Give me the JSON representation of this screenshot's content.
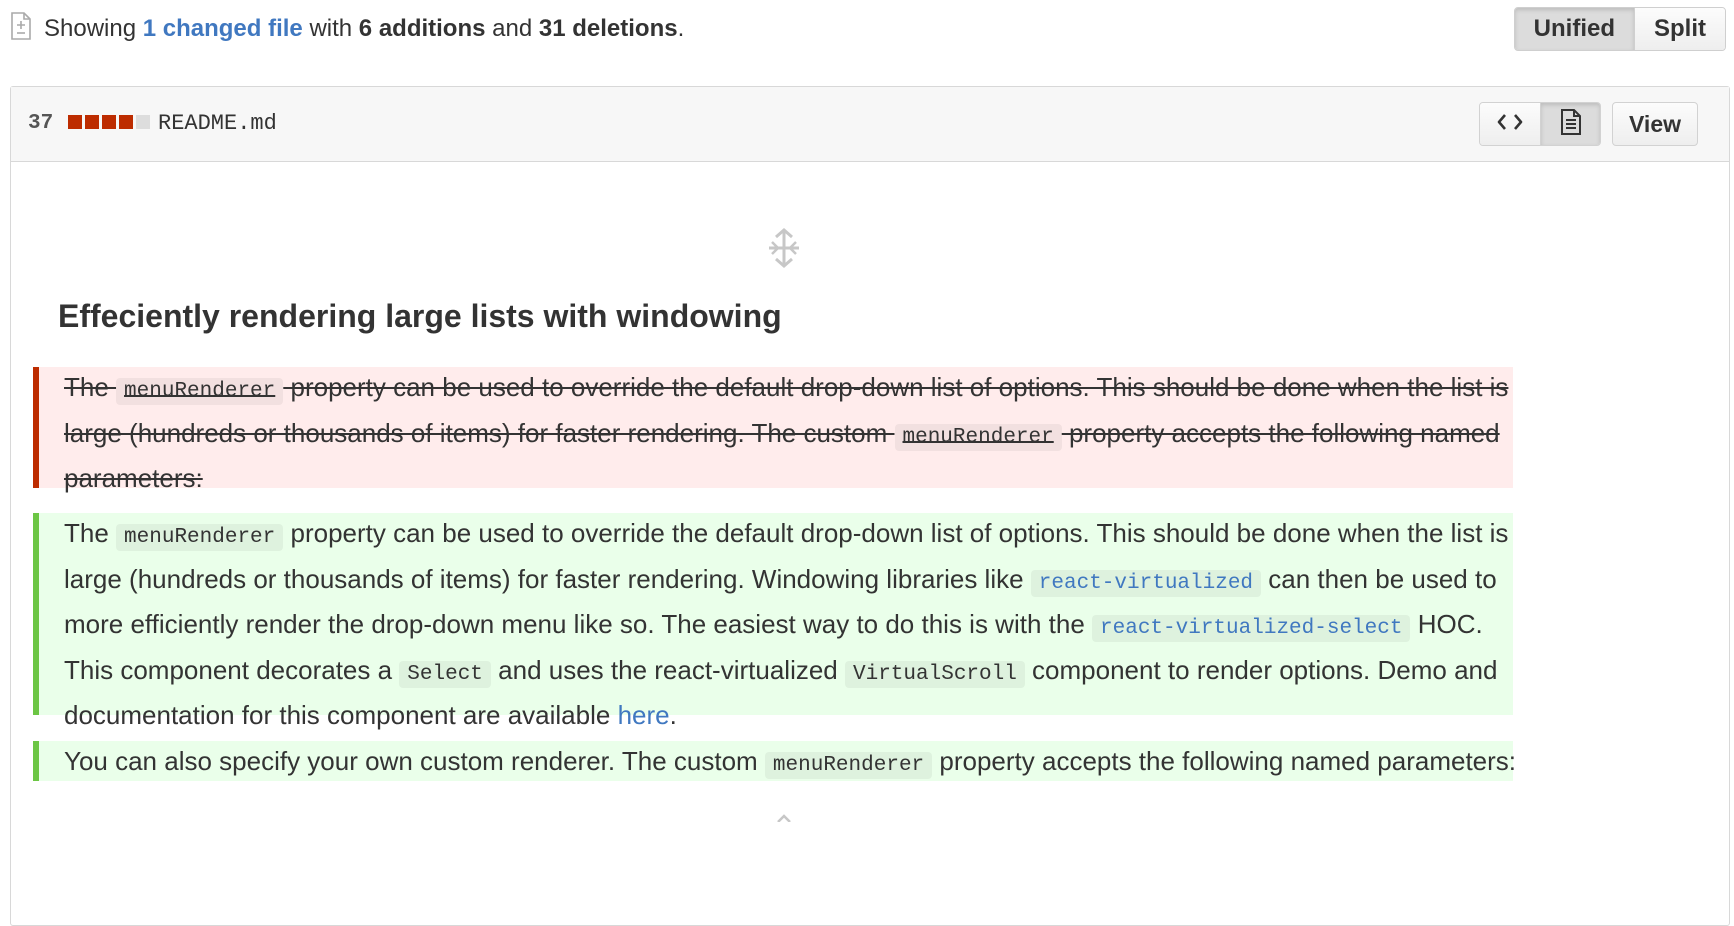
{
  "summary": {
    "prefix": "Showing ",
    "changed_files": "1 changed file",
    "with": " with ",
    "additions": "6 additions",
    "and": " and ",
    "deletions": "31 deletions",
    "suffix": ".",
    "icon": "diff-file-icon"
  },
  "view_toggle": {
    "unified": "Unified",
    "split": "Split",
    "active": "Unified"
  },
  "file": {
    "change_count": "37",
    "diffstat": {
      "deletion_blocks": 4,
      "neutral_blocks": 1,
      "deletion_color": "#bd2c00"
    },
    "name": "README.md",
    "source_view_icon": "code-icon",
    "rich_view_icon": "file-text-icon",
    "active_view": "rich",
    "view_button": "View"
  },
  "content": {
    "expand_icon": "unfold-icon",
    "heading": "Effeciently rendering large lists with windowing",
    "removed": {
      "l1_a": "The ",
      "l1_code": "menuRenderer",
      "l1_b": " property can be used to override the default drop-down list of options. This should be done when the list is",
      "l2_a": "large (hundreds or thousands of items) for faster rendering. The custom ",
      "l2_code": "menuRenderer",
      "l2_b": " property accepts the following named",
      "l3": "parameters:"
    },
    "added_p1": {
      "l1_a": "The ",
      "l1_code": "menuRenderer",
      "l1_b": " property can be used to override the default drop-down list of options. This should be done when the list is",
      "l2_a": "large (hundreds or thousands of items) for faster rendering. Windowing libraries like ",
      "l2_link": "react-virtualized",
      "l2_b": " can then be used to",
      "l3_a": "more efficiently render the drop-down menu like so. The easiest way to do this is with the ",
      "l3_link": "react-virtualized-select",
      "l3_b": " HOC.",
      "l4_a": "This component decorates a ",
      "l4_code1": "Select",
      "l4_b": " and uses the react-virtualized ",
      "l4_code2": "VirtualScroll",
      "l4_c": " component to render options. Demo and",
      "l5_a": "documentation for this component are available ",
      "l5_link": "here",
      "l5_b": "."
    },
    "added_p2": {
      "a": "You can also specify your own custom renderer. The custom ",
      "code": "menuRenderer",
      "b": " property accepts the following named parameters:"
    }
  },
  "colors": {
    "link": "#4078c0",
    "deletion_bg": "#ffecec",
    "deletion_border": "#bd2c00",
    "addition_bg": "#eaffea",
    "addition_border": "#6cc644"
  }
}
